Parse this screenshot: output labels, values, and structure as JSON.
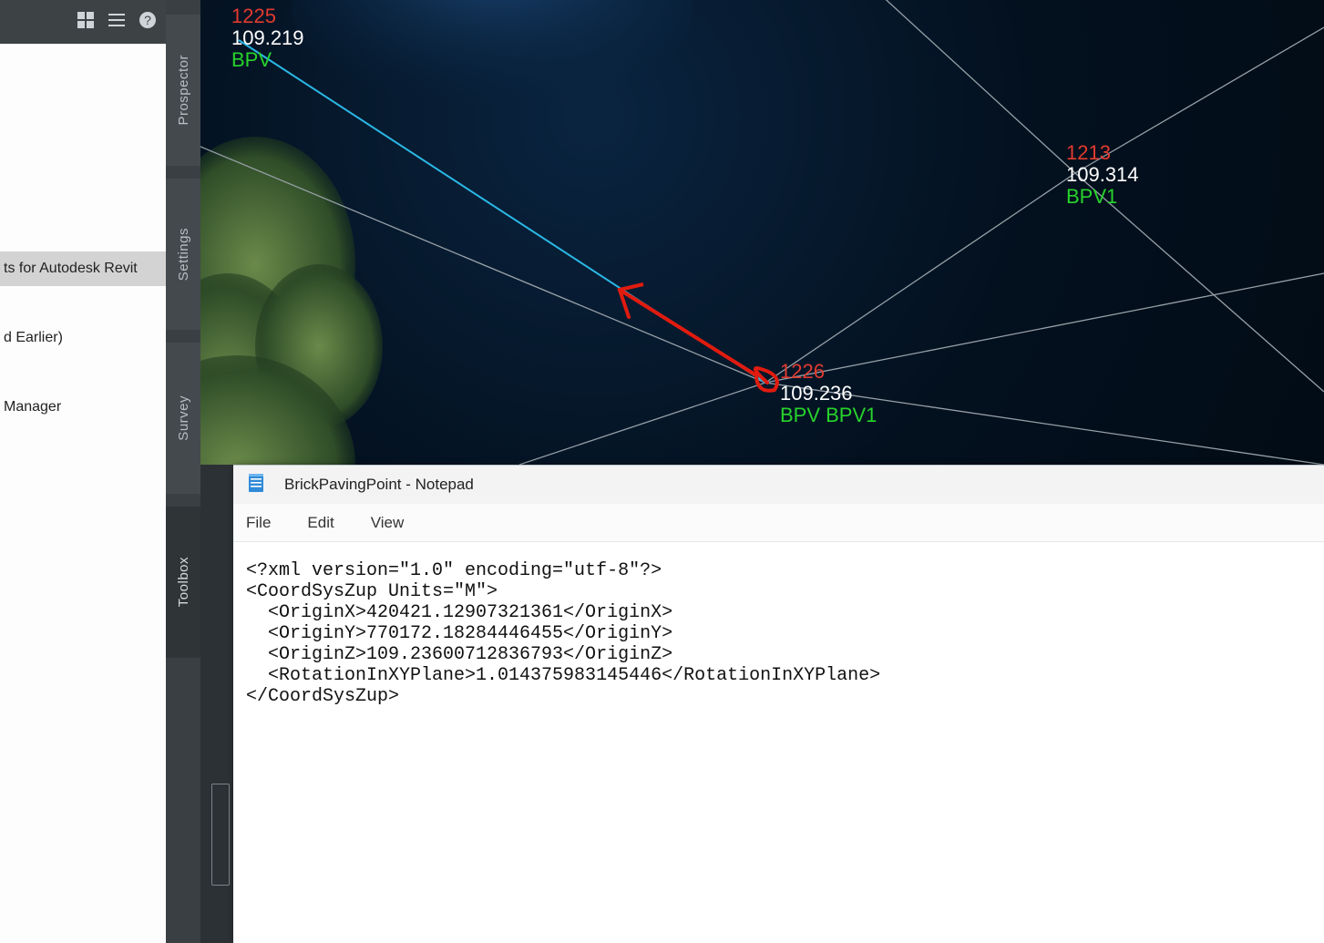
{
  "tree": {
    "items": [
      {
        "label": ""
      },
      {
        "label": ""
      },
      {
        "label": ""
      },
      {
        "label": ""
      },
      {
        "label": ""
      },
      {
        "label": ""
      },
      {
        "label": "ts for Autodesk Revit",
        "selected": true
      },
      {
        "label": ""
      },
      {
        "label": "d Earlier)"
      },
      {
        "label": ""
      },
      {
        "label": "Manager"
      }
    ]
  },
  "rail": {
    "prospector": "Prospector",
    "settings": "Settings",
    "survey": "Survey",
    "toolbox": "Toolbox"
  },
  "points": {
    "p1225": {
      "num": "1225",
      "elev": "109.219",
      "desc": "BPV"
    },
    "p1213": {
      "num": "1213",
      "elev": "109.314",
      "desc": "BPV1"
    },
    "p1226": {
      "num": "1226",
      "elev": "109.236",
      "desc": "BPV BPV1"
    }
  },
  "notepad": {
    "title": "BrickPavingPoint - Notepad",
    "menu": {
      "file": "File",
      "edit": "Edit",
      "view": "View"
    },
    "content": "<?xml version=\"1.0\" encoding=\"utf-8\"?>\n<CoordSysZup Units=\"M\">\n  <OriginX>420421.12907321361</OriginX>\n  <OriginY>770172.18284446455</OriginY>\n  <OriginZ>109.23600712836793</OriginZ>\n  <RotationInXYPlane>1.014375983145446</RotationInXYPlane>\n</CoordSysZup>"
  }
}
